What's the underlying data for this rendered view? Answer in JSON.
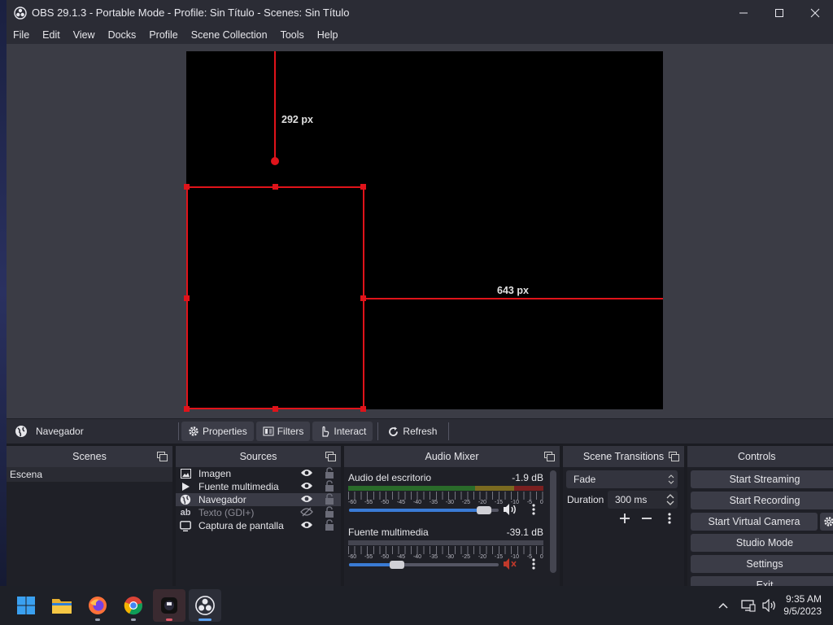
{
  "window": {
    "title": "OBS 29.1.3 - Portable Mode - Profile: Sin Título - Scenes: Sin Título"
  },
  "menu": [
    "File",
    "Edit",
    "View",
    "Docks",
    "Profile",
    "Scene Collection",
    "Tools",
    "Help"
  ],
  "preview": {
    "top_label": "292 px",
    "right_label": "643 px",
    "selection_color": "#e0131a"
  },
  "source_bar": {
    "selected_source": "Navegador",
    "properties": "Properties",
    "filters": "Filters",
    "interact": "Interact",
    "refresh": "Refresh"
  },
  "scenes": {
    "title": "Scenes",
    "items": [
      "Escena"
    ]
  },
  "sources": {
    "title": "Sources",
    "items": [
      {
        "icon": "image-icon",
        "label": "Imagen",
        "visible": true
      },
      {
        "icon": "play-icon",
        "label": "Fuente multimedia",
        "visible": true
      },
      {
        "icon": "globe-icon",
        "label": "Navegador",
        "visible": true
      },
      {
        "icon": "text-icon",
        "label": "Texto (GDI+)",
        "visible": false
      },
      {
        "icon": "monitor-icon",
        "label": "Captura de pantalla",
        "visible": true
      }
    ]
  },
  "mixer": {
    "title": "Audio Mixer",
    "tick_labels": [
      "-60",
      "-55",
      "-50",
      "-45",
      "-40",
      "-35",
      "-30",
      "-25",
      "-20",
      "-15",
      "-10",
      "-5",
      "0"
    ],
    "channels": [
      {
        "name": "Audio del escritorio",
        "db": "-1.9 dB",
        "volume": 0.9,
        "muted": false
      },
      {
        "name": "Fuente multimedia",
        "db": "-39.1 dB",
        "volume": 0.32,
        "muted": true
      }
    ]
  },
  "transitions": {
    "title": "Scene Transitions",
    "selected": "Fade",
    "duration_label": "Duration",
    "duration_value": "300 ms"
  },
  "controls": {
    "title": "Controls",
    "start_streaming": "Start Streaming",
    "start_recording": "Start Recording",
    "start_virtual_camera": "Start Virtual Camera",
    "studio_mode": "Studio Mode",
    "settings": "Settings",
    "exit": "Exit"
  },
  "taskbar": {
    "time": "9:35 AM",
    "date": "9/5/2023"
  },
  "colors": {
    "accent": "#3a7bd5",
    "mute": "#c0392b"
  }
}
